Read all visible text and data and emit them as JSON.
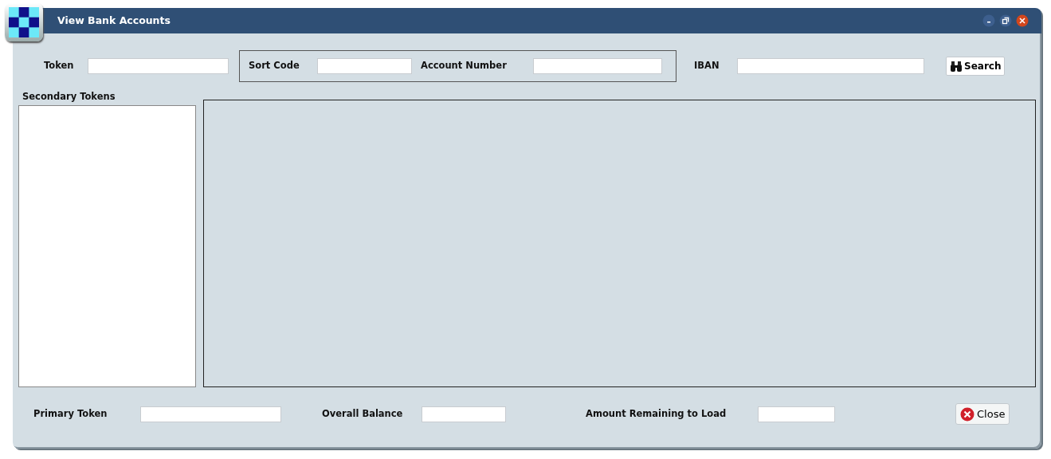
{
  "window": {
    "title": "View Bank Accounts"
  },
  "search_row": {
    "token": {
      "label": "Token"
    },
    "sort_group": [
      {
        "label": "Sort Code"
      },
      {
        "label": "Account Number"
      }
    ],
    "iban": {
      "label": "IBAN"
    },
    "search_button": "Search"
  },
  "secondary_tokens": {
    "label": "Secondary Tokens"
  },
  "footer": {
    "fields": [
      {
        "label": "Primary Token"
      },
      {
        "label": "Overall Balance"
      },
      {
        "label": "Amount Remaining to Load"
      }
    ],
    "close_button": "Close"
  }
}
